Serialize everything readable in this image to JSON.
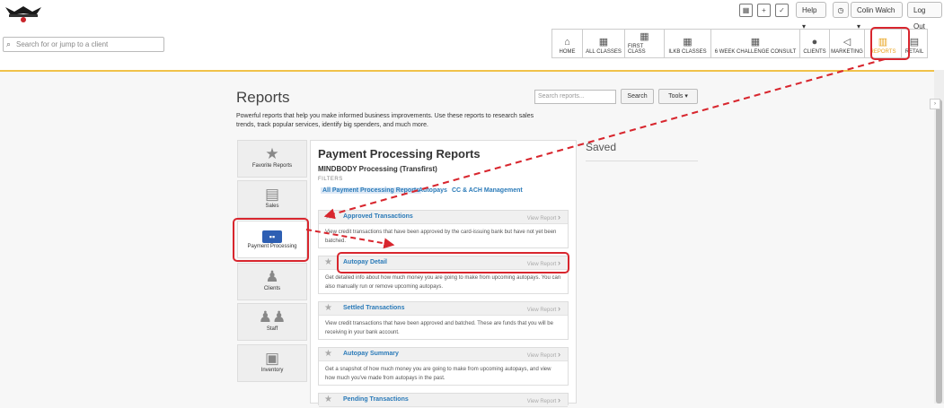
{
  "header": {
    "logo": "logo-icon",
    "utility_icons": [
      "calendar-icon",
      "add-icon",
      "checkbox-icon"
    ],
    "help_label": "Help",
    "clock_icon": "clock-icon",
    "user_label": "Colin Walch",
    "logout_label": "Log Out",
    "search_placeholder": "Search for or jump to a client"
  },
  "nav": {
    "items": [
      {
        "label": "HOME",
        "icon": "home-icon"
      },
      {
        "label": "ALL CLASSES",
        "icon": "calendar-icon"
      },
      {
        "label": "FIRST CLASS",
        "icon": "calendar-icon"
      },
      {
        "label": "ILKB CLASSES",
        "icon": "calendar-icon"
      },
      {
        "label": "6 WEEK CHALLENGE CONSULT",
        "icon": "calendar-icon"
      },
      {
        "label": "CLIENTS",
        "icon": "person-icon"
      },
      {
        "label": "MARKETING",
        "icon": "megaphone-icon"
      },
      {
        "label": "REPORTS",
        "icon": "bar-chart-icon",
        "active": true
      },
      {
        "label": "RETAIL",
        "icon": "register-icon"
      }
    ],
    "active_color": "#e8a21a"
  },
  "page": {
    "title": "Reports",
    "description": "Powerful reports that help you make informed business improvements. Use these reports to research sales trends, track popular services, identify big spenders, and much more.",
    "search_placeholder": "Search reports...",
    "search_button": "Search",
    "tools_label": "Tools"
  },
  "categories": [
    {
      "label": "Favorite Reports",
      "icon": "star-icon"
    },
    {
      "label": "Sales",
      "icon": "cash-register-icon"
    },
    {
      "label": "Payment Processing",
      "icon": "credit-card-icon",
      "selected": true
    },
    {
      "label": "Clients",
      "icon": "clients-icon"
    },
    {
      "label": "Staff",
      "icon": "staff-icon"
    },
    {
      "label": "Inventory",
      "icon": "inventory-icon"
    }
  ],
  "panel": {
    "title": "Payment Processing Reports",
    "subtitle": "MINDBODY Processing (Transfirst)",
    "filters_label": "FILTERS",
    "filters": [
      "All Payment Processing Reports",
      "Autopays",
      "CC & ACH Management"
    ],
    "view_label": "View Report",
    "reports": [
      {
        "name": "Approved Transactions",
        "desc": "View credit transactions that have been approved by the card-issuing bank but have not yet been batched."
      },
      {
        "name": "Autopay Detail",
        "desc": "Get detailed info about how much money you are going to make from upcoming autopays. You can also manually run or remove upcoming autopays."
      },
      {
        "name": "Settled Transactions",
        "desc": "View credit transactions that have been approved and batched. These are funds that you will be receiving in your bank account."
      },
      {
        "name": "Autopay Summary",
        "desc": "Get a snapshot of how much money you are going to make from upcoming autopays, and view how much you've made from autopays in the past."
      },
      {
        "name": "Pending Transactions",
        "desc": ""
      }
    ]
  },
  "saved": {
    "title": "Saved"
  },
  "colors": {
    "link": "#2a7ab8",
    "highlight": "#d8262e",
    "accent": "#f0c24a"
  }
}
